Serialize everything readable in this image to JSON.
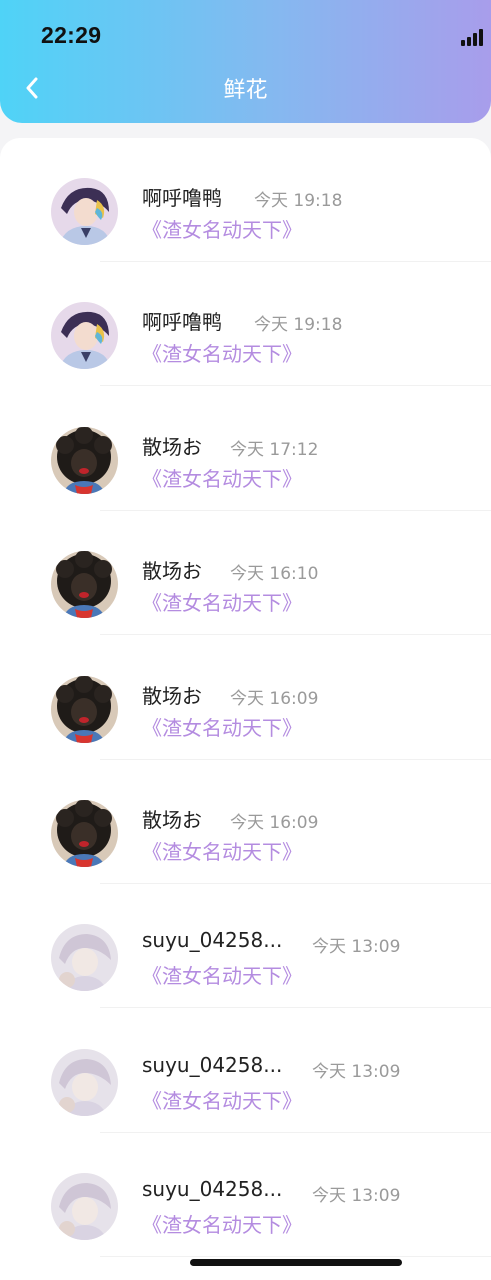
{
  "status_bar": {
    "time": "22:29"
  },
  "header": {
    "title": "鲜花",
    "back_icon": "chevron-left-icon"
  },
  "rows": [
    {
      "avatar": "anime-boy-avatar",
      "name": "啊呼噜鸭",
      "time": "今天 19:18",
      "book": "《渣女名动天下》"
    },
    {
      "avatar": "anime-boy-avatar",
      "name": "啊呼噜鸭",
      "time": "今天 19:18",
      "book": "《渣女名动天下》"
    },
    {
      "avatar": "dark-curly-avatar",
      "name": "散场お",
      "time": "今天 17:12",
      "book": "《渣女名动天下》"
    },
    {
      "avatar": "dark-curly-avatar",
      "name": "散场お",
      "time": "今天 16:10",
      "book": "《渣女名动天下》"
    },
    {
      "avatar": "dark-curly-avatar",
      "name": "散场お",
      "time": "今天 16:09",
      "book": "《渣女名动天下》"
    },
    {
      "avatar": "dark-curly-avatar",
      "name": "散场お",
      "time": "今天 16:09",
      "book": "《渣女名动天下》"
    },
    {
      "avatar": "pale-anime-avatar",
      "name": "suyu_04258...",
      "time": "今天 13:09",
      "book": "《渣女名动天下》"
    },
    {
      "avatar": "pale-anime-avatar",
      "name": "suyu_04258...",
      "time": "今天 13:09",
      "book": "《渣女名动天下》"
    },
    {
      "avatar": "pale-anime-avatar",
      "name": "suyu_04258...",
      "time": "今天 13:09",
      "book": "《渣女名动天下》"
    }
  ],
  "colors": {
    "header_gradient_start": "#4fd3f7",
    "header_gradient_end": "#a89deb",
    "book_title": "#b48ce0",
    "time_text": "#9a9a9a"
  }
}
